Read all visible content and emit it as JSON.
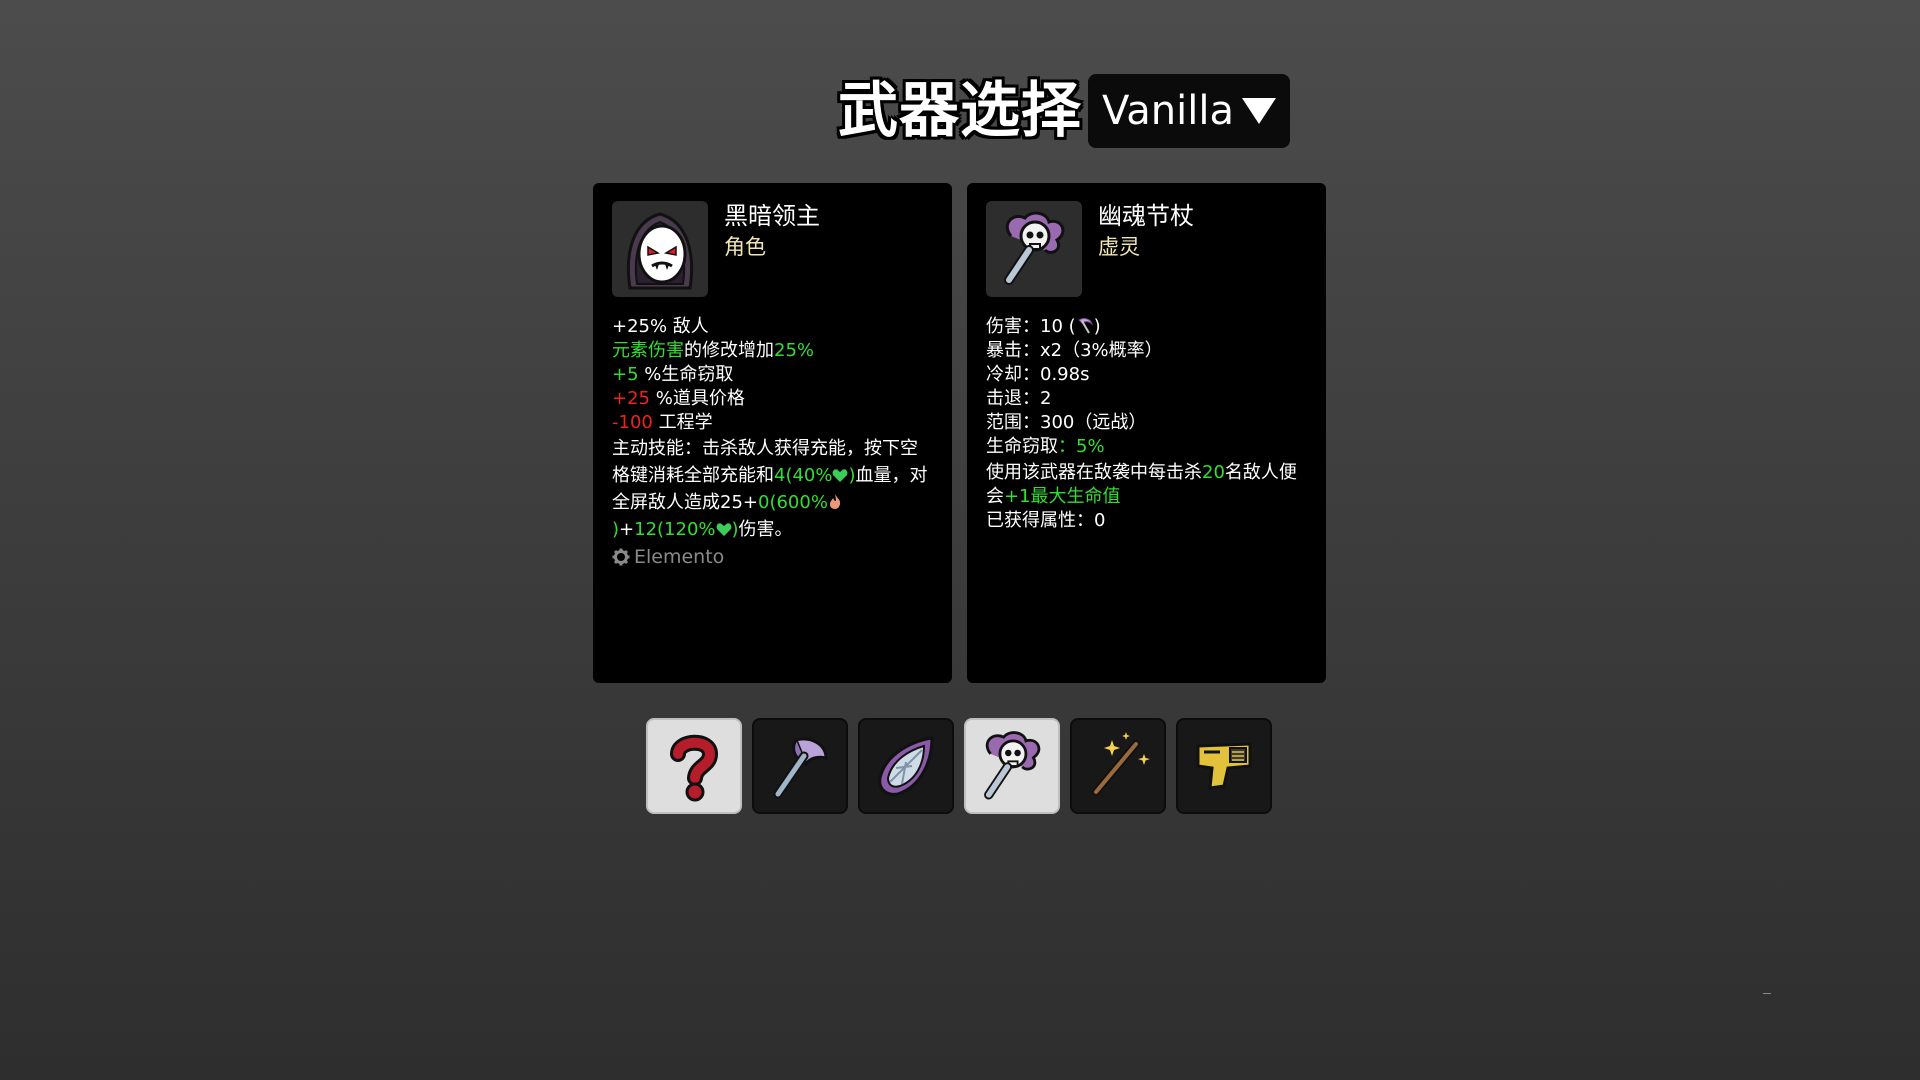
{
  "header": {
    "title": "武器选择",
    "dropdown_value": "Vanilla"
  },
  "character_panel": {
    "name": "黑暗领主",
    "type": "角色",
    "line1": "+25% 敌人",
    "line2_a": "元素伤害",
    "line2_b": "的修改增加",
    "line2_c": "25%",
    "line3_a": "+5",
    "line3_b": " %生命窃取",
    "line4_a": "+25",
    "line4_b": " %道具价格",
    "line5_a": "-100",
    "line5_b": " 工程学",
    "skill_a": "主动技能：击杀敌人获得充能，按下空格键消耗全部充能和",
    "skill_b": "4(40%",
    "skill_c": ")",
    "skill_d": "血量，对全屏敌人造成25+",
    "skill_e": "0(600%",
    "skill_f": ")",
    "skill_g": "+",
    "skill_h": "12(120%",
    "skill_i": ")",
    "skill_j": "伤害。",
    "mod_label": "Elemento"
  },
  "weapon_panel": {
    "name": "幽魂节杖",
    "type": "虚灵",
    "damage_label": "伤害",
    "damage_value": "：10 (",
    "damage_close": ")",
    "crit_label": "暴击",
    "crit_value": "：x2（3%概率）",
    "cooldown_label": "冷却",
    "cooldown_value": "：0.98s",
    "knockback_label": "击退",
    "knockback_value": "：2",
    "range_label": "范围",
    "range_value": "：300（远战）",
    "lifesteal_label": "生命窃取",
    "lifesteal_colon": "：",
    "lifesteal_value": "5%",
    "effect_a": "使用该武器在敌袭中每击杀",
    "effect_b": "20",
    "effect_c": "名敌人便会",
    "effect_d": "+1最大生命值",
    "gained_label": "已获得属性：0"
  },
  "weapon_slots": [
    {
      "icon": "question-mark-icon",
      "selected": true
    },
    {
      "icon": "axe-icon",
      "selected": false
    },
    {
      "icon": "crystal-shard-icon",
      "selected": false
    },
    {
      "icon": "ghost-scepter-icon",
      "selected": true
    },
    {
      "icon": "magic-wand-icon",
      "selected": false
    },
    {
      "icon": "taser-icon",
      "selected": false
    }
  ],
  "colors": {
    "positive": "#33dd33",
    "negative": "#ee2222",
    "type_text": "#f1e6b4",
    "panel_bg": "#000000"
  }
}
